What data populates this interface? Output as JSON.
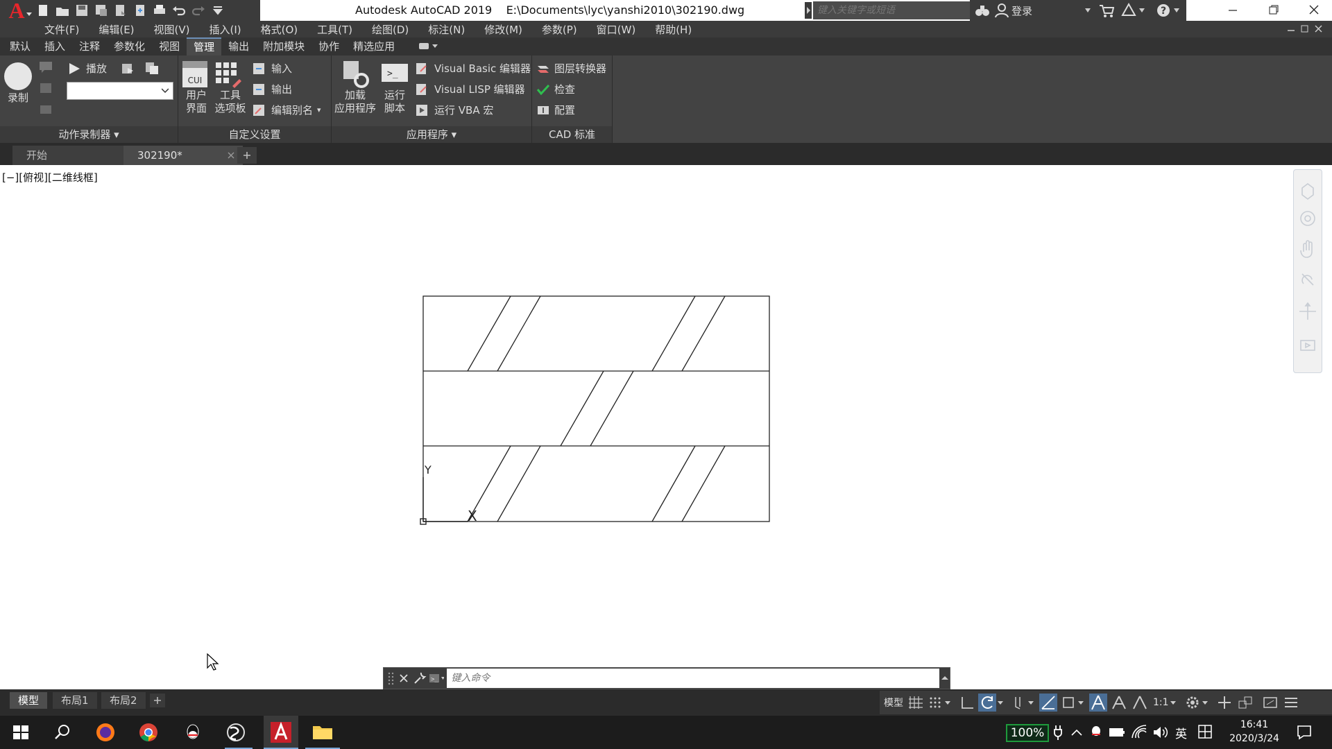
{
  "window": {
    "title": "Autodesk AutoCAD 2019    E:\\Documents\\lyc\\yanshi2010\\302190.dwg",
    "app_letter": "A",
    "search_placeholder": "键入关键字或短语",
    "login": "登录"
  },
  "menu": [
    "文件(F)",
    "编辑(E)",
    "视图(V)",
    "插入(I)",
    "格式(O)",
    "工具(T)",
    "绘图(D)",
    "标注(N)",
    "修改(M)",
    "参数(P)",
    "窗口(W)",
    "帮助(H)"
  ],
  "ribbon_tabs": [
    "默认",
    "插入",
    "注释",
    "参数化",
    "视图",
    "管理",
    "输出",
    "附加模块",
    "协作",
    "精选应用"
  ],
  "active_tab": "管理",
  "ribbon": {
    "record": "录制",
    "play": "播放",
    "panel_action": "动作录制器",
    "user_interface_l1": "用户",
    "user_interface_l2": "界面",
    "cui": "CUI",
    "tool_palettes_l1": "工具",
    "tool_palettes_l2": "选项板",
    "import": "输入",
    "export": "输出",
    "edit_aliases": "编辑别名",
    "panel_customize": "自定义设置",
    "load_app_l1": "加载",
    "load_app_l2": "应用程序",
    "run_script_l1": "运行",
    "run_script_l2": "脚本",
    "vb_editor": "Visual Basic 编辑器",
    "lisp_editor": "Visual LISP 编辑器",
    "run_vba": "运行 VBA 宏",
    "panel_apps": "应用程序",
    "layer_translator": "图层转换器",
    "check": "检查",
    "configure": "配置",
    "panel_cad": "CAD 标准"
  },
  "doc_tabs": [
    "开始",
    "302190*"
  ],
  "view_label": "[−][俯视][二维线框]",
  "ucs": {
    "x": "X",
    "y": "Y"
  },
  "command_placeholder": "键入命令",
  "layout_tabs": [
    "模型",
    "布局1",
    "布局2"
  ],
  "status": {
    "model": "模型",
    "scale": "1:1"
  },
  "taskbar": {
    "battery": "100%",
    "ime": "英",
    "time": "16:41",
    "date": "2020/3/24"
  },
  "colors": {
    "dark_bg": "#3b3b3b",
    "ribbon_bg": "#434343",
    "accent": "#6c8fb8",
    "logo_red": "#e8262b",
    "battery_green": "#1e9b3c"
  }
}
